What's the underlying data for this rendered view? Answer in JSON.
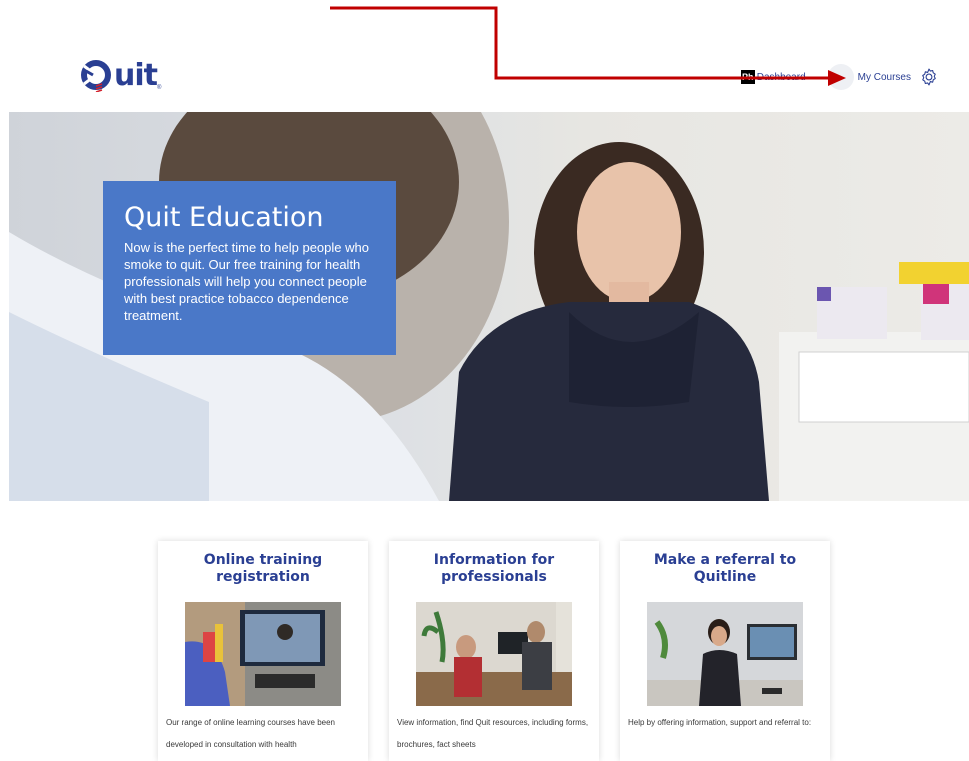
{
  "logo": {
    "text": "uit",
    "tm": "®"
  },
  "nav": {
    "dashboard_icon": "Ph",
    "dashboard_label": "Dashboard",
    "courses_label": "My Courses",
    "settings_icon": "gear-icon"
  },
  "hero": {
    "title": "Quit Education",
    "body": "Now is the perfect time to help people who smoke to quit. Our free training for health professionals will help you connect people with best practice tobacco dependence treatment."
  },
  "cards": [
    {
      "title": "Online training registration",
      "desc": "Our range of online learning courses have been developed in consultation with health"
    },
    {
      "title": "Information for professionals",
      "desc": "View information, find Quit resources, including forms, brochures, fact sheets"
    },
    {
      "title": "Make a referral to Quitline",
      "desc": "Help by offering information, support and referral to:"
    }
  ],
  "colors": {
    "brand": "#2a3f93",
    "hero_box": "#4a78c8",
    "annotation": "#c00000"
  }
}
